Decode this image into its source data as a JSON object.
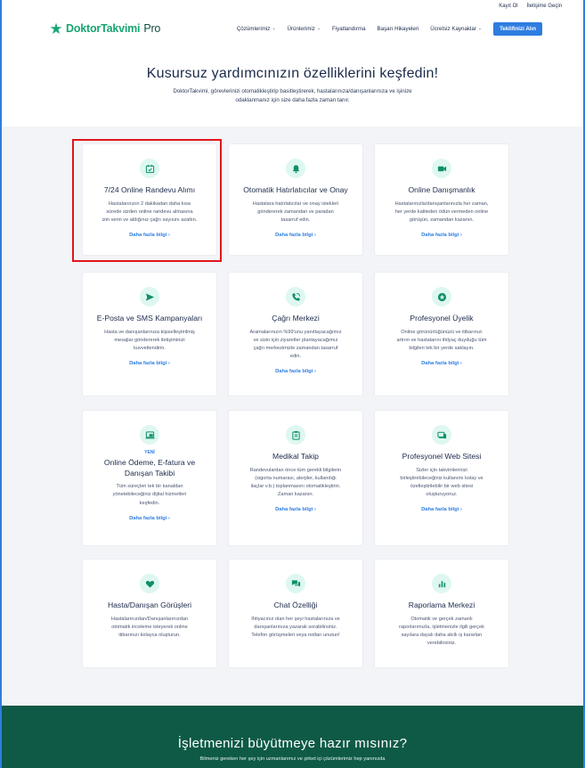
{
  "topbar": {
    "login": "Kayıt Ol",
    "contact": "İletişime Geçin"
  },
  "logo": {
    "part1": "DoktorTakvimi",
    "part2": "Pro"
  },
  "nav": {
    "items": [
      {
        "label": "Çözümlerimiz",
        "dropdown": true
      },
      {
        "label": "Ürünlerimiz",
        "dropdown": true
      },
      {
        "label": "Fiyatlandırma",
        "dropdown": false
      },
      {
        "label": "Başarı Hikayeleri",
        "dropdown": false
      },
      {
        "label": "Ücretsiz Kaynaklar",
        "dropdown": true
      }
    ],
    "cta": "Teklifinizi Alın",
    "caret": "⌄"
  },
  "hero": {
    "title": "Kusursuz yardımcınızın özelliklerini keşfedin!",
    "subtitle_line1": "DoktorTakvimi, görevlerinizi otomatikleştirip basitleştirerek, hastalarınıza/danışanlarınıza ve işinize",
    "subtitle_line2": "odaklanmanız için size daha fazla zaman tanır."
  },
  "more_label": "Daha fazla bilgi",
  "more_arrow": "›",
  "cards": [
    {
      "icon": "calendar-check-icon",
      "title": "7/24 Online Randevu Alımı",
      "desc": [
        "Hastalarınızın 2 dakikadan daha kısa",
        "sürede sizden online randevu almasına",
        "izin verin ve aldığınız çağrı sayısını azaltın."
      ],
      "more": true
    },
    {
      "icon": "bell-icon",
      "title": "Otomatik Hatırlatıcılar ve Onay",
      "desc": [
        "Hastalara hatırlatıcılar ve onay istekleri",
        "göndererek zamandan ve paradan",
        "tasarruf edin."
      ],
      "more": true
    },
    {
      "icon": "video-camera-icon",
      "title": "Online Danışmanlık",
      "desc": [
        "Hastalarınızla/danışanlarınızla her zaman,",
        "her yerde kaliteden ödün vermeden online",
        "görüşün, zamandan kazanın."
      ],
      "more": true
    },
    {
      "icon": "send-icon",
      "title": "E-Posta ve SMS Kampanyaları",
      "desc": [
        "Hasta ve danışanlarınıza kişiselleştirilmiş",
        "mesajlar göndererek iletişiminizi",
        "kuvvetlendirin."
      ],
      "more": true
    },
    {
      "icon": "phone-call-icon",
      "title": "Çağrı Merkezi",
      "desc": [
        "Aramalarınızın %99'unu yanıtlayacağımız",
        "ve sizin için ziyaretler planlayacağımız",
        "çağrı merkezimizle zamandan tasarruf",
        "edin."
      ],
      "more": true
    },
    {
      "icon": "star-badge-icon",
      "title": "Profesyonel Üyelik",
      "desc": [
        "Online görünürlüğünüzü ve itibarınızı",
        "artırın ve hastalarını ihtiyaç duyduğu tüm",
        "bilgileri tek bir yerde saklayın."
      ],
      "more": true
    },
    {
      "icon": "payment-screen-icon",
      "badge": "YENİ",
      "title_line1": "Online Ödeme, E-fatura ve",
      "title_line2": "Danışan Takibi",
      "desc": [
        "Tüm süreçleri tek bir kanaldan",
        "yönetebileceğiniz dijital hizmetleri",
        "keşfedin."
      ],
      "more": true
    },
    {
      "icon": "clipboard-icon",
      "title": "Medikal Takip",
      "desc": [
        "Randevulardan önce tüm gerekli bilgilerin",
        "(sigorta numarası, alerjiler, kullandığı",
        "ilaçlar v.b.) toplanmasını otomatikleştirin.",
        "Zaman kazanın."
      ],
      "more": true
    },
    {
      "icon": "website-devices-icon",
      "title": "Profesyonel Web Sitesi",
      "desc": [
        "Sizler için takvimlerinizi",
        "birleştirebileceğiniz kullanımı kolay ve",
        "özelleştirilebilir bir web sitesi",
        "oluşturuyoruz."
      ],
      "more": true
    },
    {
      "icon": "heart-icon",
      "title": "Hasta/Danışan Görüşleri",
      "desc": [
        "Hastalarınızdan/Danışanlarınızdan",
        "otomatik inceleme isteyerek online",
        "itibarınızı kolayca oluşturun."
      ],
      "more": false
    },
    {
      "icon": "chat-bubbles-icon",
      "title": "Chat Özelliği",
      "desc": [
        "İhtiyacınız olan her şeyi hastalarınıza ve",
        "danışanlarınıza yazarak sorabilirsiniz.",
        "Telefon görüşmeleri veya notları unutun!"
      ],
      "more": false
    },
    {
      "icon": "bar-chart-icon",
      "title": "Raporlama Merkezi",
      "desc": [
        "Otomatik ve gerçek zamanlı",
        "raporlarımızla, işletmenizle ilgili gerçek",
        "sayılara dayalı daha akıllı iş kararları",
        "verebilirsiniz."
      ],
      "more": false
    }
  ],
  "footer": {
    "title": "İşletmenizi büyütmeye hazır mısınız?",
    "subtitle": "Bilmeniz gereken her şey için uzmanlarımız ve şirket içi çözümlerimiz hep yanınızda"
  },
  "colors": {
    "accent": "#2f7de1",
    "brand": "#18a673",
    "icon_bg": "#def7f0",
    "footer_bg": "#0e5a47",
    "highlight": "#e0161c"
  }
}
